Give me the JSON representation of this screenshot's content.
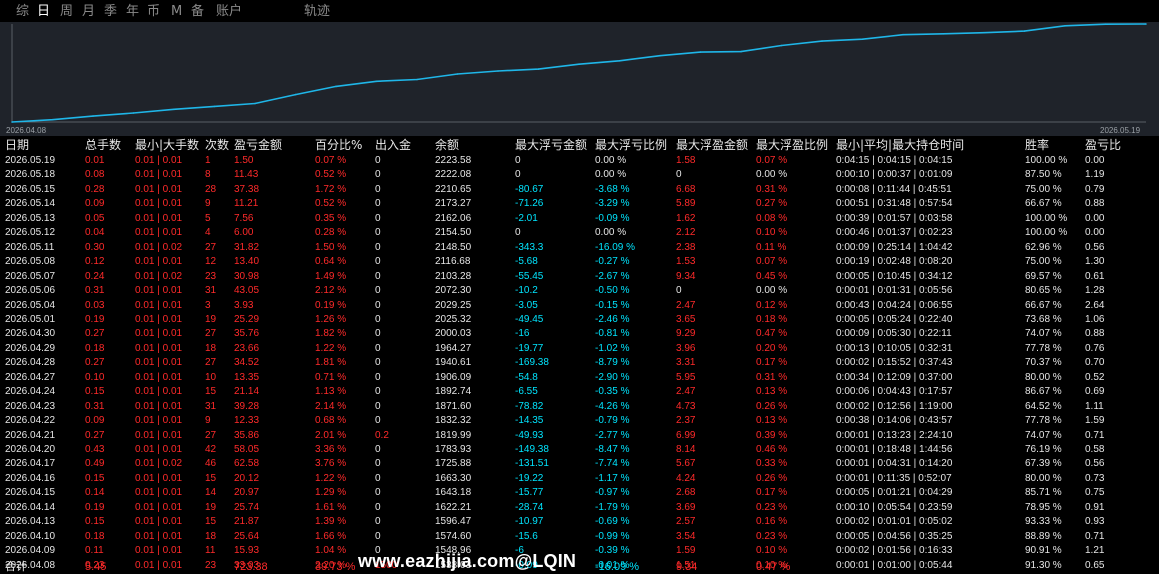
{
  "tabs": [
    {
      "label": "综",
      "active": false
    },
    {
      "label": "日",
      "active": true
    },
    {
      "label": "周",
      "active": false
    },
    {
      "label": "月",
      "active": false
    },
    {
      "label": "季",
      "active": false
    },
    {
      "label": "年",
      "active": false
    },
    {
      "label": "币",
      "active": false
    },
    {
      "label": "M",
      "active": false
    },
    {
      "label": "备",
      "active": false
    },
    {
      "label": "账户",
      "active": false
    },
    {
      "label": "轨迹",
      "active": false
    }
  ],
  "colors": {
    "line": "#1fb6e8",
    "panel": "#1f232a",
    "red": "#ff2a2a",
    "cyan": "#00e5ff"
  },
  "chart_data": {
    "type": "line",
    "x_start_label": "2026.04.08",
    "x_end_label": "2026.05.19",
    "x": [
      "2026.04.08",
      "2026.04.09",
      "2026.04.10",
      "2026.04.13",
      "2026.04.14",
      "2026.04.15",
      "2026.04.16",
      "2026.04.17",
      "2026.04.20",
      "2026.04.21",
      "2026.04.22",
      "2026.04.23",
      "2026.04.24",
      "2026.04.27",
      "2026.04.28",
      "2026.04.29",
      "2026.04.30",
      "2026.05.01",
      "2026.05.04",
      "2026.05.06",
      "2026.05.07",
      "2026.05.08",
      "2026.05.11",
      "2026.05.12",
      "2026.05.13",
      "2026.05.14",
      "2026.05.15",
      "2026.05.18",
      "2026.05.19"
    ],
    "values": [
      1533.03,
      1548.96,
      1574.6,
      1596.47,
      1622.21,
      1643.18,
      1663.3,
      1725.88,
      1783.93,
      1819.99,
      1832.32,
      1871.6,
      1892.74,
      1906.09,
      1940.61,
      1964.27,
      2000.03,
      2025.32,
      2029.25,
      2072.3,
      2103.28,
      2116.68,
      2148.5,
      2154.5,
      2162.06,
      2173.27,
      2210.65,
      2222.08,
      2223.58
    ],
    "grid": false,
    "legend": false
  },
  "headers": [
    "日期",
    "总手数",
    "最小|大手数",
    "次数",
    "盈亏金额",
    "百分比%",
    "出入金",
    "余额",
    "最大浮亏金额",
    "最大浮亏比例",
    "最大浮盈金额",
    "最大浮盈比例",
    "最小|平均|最大持仓时间",
    "胜率",
    "盈亏比"
  ],
  "rows": [
    [
      "2026.05.19",
      "0.01",
      "0.01 | 0.01",
      "1",
      "1.50",
      "0.07 %",
      "0",
      "2223.58",
      "0",
      "0.00 %",
      "1.58",
      "0.07 %",
      "0:04:15 | 0:04:15 | 0:04:15",
      "100.00 %",
      "0.00"
    ],
    [
      "2026.05.18",
      "0.08",
      "0.01 | 0.01",
      "8",
      "11.43",
      "0.52 %",
      "0",
      "2222.08",
      "0",
      "0.00 %",
      "0",
      "0.00 %",
      "0:00:10 | 0:00:37 | 0:01:09",
      "87.50 %",
      "1.19"
    ],
    [
      "2026.05.15",
      "0.28",
      "0.01 | 0.01",
      "28",
      "37.38",
      "1.72 %",
      "0",
      "2210.65",
      "-80.67",
      "-3.68 %",
      "6.68",
      "0.31 %",
      "0:00:08 | 0:11:44 | 0:45:51",
      "75.00 %",
      "0.79"
    ],
    [
      "2026.05.14",
      "0.09",
      "0.01 | 0.01",
      "9",
      "11.21",
      "0.52 %",
      "0",
      "2173.27",
      "-71.26",
      "-3.29 %",
      "5.89",
      "0.27 %",
      "0:00:51 | 0:31:48 | 0:57:54",
      "66.67 %",
      "0.88"
    ],
    [
      "2026.05.13",
      "0.05",
      "0.01 | 0.01",
      "5",
      "7.56",
      "0.35 %",
      "0",
      "2162.06",
      "-2.01",
      "-0.09 %",
      "1.62",
      "0.08 %",
      "0:00:39 | 0:01:57 | 0:03:58",
      "100.00 %",
      "0.00"
    ],
    [
      "2026.05.12",
      "0.04",
      "0.01 | 0.01",
      "4",
      "6.00",
      "0.28 %",
      "0",
      "2154.50",
      "0",
      "0.00 %",
      "2.12",
      "0.10 %",
      "0:00:46 | 0:01:37 | 0:02:23",
      "100.00 %",
      "0.00"
    ],
    [
      "2026.05.11",
      "0.30",
      "0.01 | 0.02",
      "27",
      "31.82",
      "1.50 %",
      "0",
      "2148.50",
      "-343.3",
      "-16.09 %",
      "2.38",
      "0.11 %",
      "0:00:09 | 0:25:14 | 1:04:42",
      "62.96 %",
      "0.56"
    ],
    [
      "2026.05.08",
      "0.12",
      "0.01 | 0.01",
      "12",
      "13.40",
      "0.64 %",
      "0",
      "2116.68",
      "-5.68",
      "-0.27 %",
      "1.53",
      "0.07 %",
      "0:00:19 | 0:02:48 | 0:08:20",
      "75.00 %",
      "1.30"
    ],
    [
      "2026.05.07",
      "0.24",
      "0.01 | 0.02",
      "23",
      "30.98",
      "1.49 %",
      "0",
      "2103.28",
      "-55.45",
      "-2.67 %",
      "9.34",
      "0.45 %",
      "0:00:05 | 0:10:45 | 0:34:12",
      "69.57 %",
      "0.61"
    ],
    [
      "2026.05.06",
      "0.31",
      "0.01 | 0.01",
      "31",
      "43.05",
      "2.12 %",
      "0",
      "2072.30",
      "-10.2",
      "-0.50 %",
      "0",
      "0.00 %",
      "0:00:01 | 0:01:31 | 0:05:56",
      "80.65 %",
      "1.28"
    ],
    [
      "2026.05.04",
      "0.03",
      "0.01 | 0.01",
      "3",
      "3.93",
      "0.19 %",
      "0",
      "2029.25",
      "-3.05",
      "-0.15 %",
      "2.47",
      "0.12 %",
      "0:00:43 | 0:04:24 | 0:06:55",
      "66.67 %",
      "2.64"
    ],
    [
      "2026.05.01",
      "0.19",
      "0.01 | 0.01",
      "19",
      "25.29",
      "1.26 %",
      "0",
      "2025.32",
      "-49.45",
      "-2.46 %",
      "3.65",
      "0.18 %",
      "0:00:05 | 0:05:24 | 0:22:40",
      "73.68 %",
      "1.06"
    ],
    [
      "2026.04.30",
      "0.27",
      "0.01 | 0.01",
      "27",
      "35.76",
      "1.82 %",
      "0",
      "2000.03",
      "-16",
      "-0.81 %",
      "9.29",
      "0.47 %",
      "0:00:09 | 0:05:30 | 0:22:11",
      "74.07 %",
      "0.88"
    ],
    [
      "2026.04.29",
      "0.18",
      "0.01 | 0.01",
      "18",
      "23.66",
      "1.22 %",
      "0",
      "1964.27",
      "-19.77",
      "-1.02 %",
      "3.96",
      "0.20 %",
      "0:00:13 | 0:10:05 | 0:32:31",
      "77.78 %",
      "0.76"
    ],
    [
      "2026.04.28",
      "0.27",
      "0.01 | 0.01",
      "27",
      "34.52",
      "1.81 %",
      "0",
      "1940.61",
      "-169.38",
      "-8.79 %",
      "3.31",
      "0.17 %",
      "0:00:02 | 0:15:52 | 0:37:43",
      "70.37 %",
      "0.70"
    ],
    [
      "2026.04.27",
      "0.10",
      "0.01 | 0.01",
      "10",
      "13.35",
      "0.71 %",
      "0",
      "1906.09",
      "-54.8",
      "-2.90 %",
      "5.95",
      "0.31 %",
      "0:00:34 | 0:12:09 | 0:37:00",
      "80.00 %",
      "0.52"
    ],
    [
      "2026.04.24",
      "0.15",
      "0.01 | 0.01",
      "15",
      "21.14",
      "1.13 %",
      "0",
      "1892.74",
      "-6.55",
      "-0.35 %",
      "2.47",
      "0.13 %",
      "0:00:06 | 0:04:43 | 0:17:57",
      "86.67 %",
      "0.69"
    ],
    [
      "2026.04.23",
      "0.31",
      "0.01 | 0.01",
      "31",
      "39.28",
      "2.14 %",
      "0",
      "1871.60",
      "-78.82",
      "-4.26 %",
      "4.73",
      "0.26 %",
      "0:00:02 | 0:12:56 | 1:19:00",
      "64.52 %",
      "1.11"
    ],
    [
      "2026.04.22",
      "0.09",
      "0.01 | 0.01",
      "9",
      "12.33",
      "0.68 %",
      "0",
      "1832.32",
      "-14.35",
      "-0.79 %",
      "2.37",
      "0.13 %",
      "0:00:38 | 0:14:06 | 0:43:57",
      "77.78 %",
      "1.59"
    ],
    [
      "2026.04.21",
      "0.27",
      "0.01 | 0.01",
      "27",
      "35.86",
      "2.01 %",
      "0.2",
      "1819.99",
      "-49.93",
      "-2.77 %",
      "6.99",
      "0.39 %",
      "0:00:01 | 0:13:23 | 2:24:10",
      "74.07 %",
      "0.71"
    ],
    [
      "2026.04.20",
      "0.43",
      "0.01 | 0.01",
      "42",
      "58.05",
      "3.36 %",
      "0",
      "1783.93",
      "-149.38",
      "-8.47 %",
      "8.14",
      "0.46 %",
      "0:00:01 | 0:18:48 | 1:44:56",
      "76.19 %",
      "0.58"
    ],
    [
      "2026.04.17",
      "0.49",
      "0.01 | 0.02",
      "46",
      "62.58",
      "3.76 %",
      "0",
      "1725.88",
      "-131.51",
      "-7.74 %",
      "5.67",
      "0.33 %",
      "0:00:01 | 0:04:31 | 0:14:20",
      "67.39 %",
      "0.56"
    ],
    [
      "2026.04.16",
      "0.15",
      "0.01 | 0.01",
      "15",
      "20.12",
      "1.22 %",
      "0",
      "1663.30",
      "-19.22",
      "-1.17 %",
      "4.24",
      "0.26 %",
      "0:00:01 | 0:11:35 | 0:52:07",
      "80.00 %",
      "0.73"
    ],
    [
      "2026.04.15",
      "0.14",
      "0.01 | 0.01",
      "14",
      "20.97",
      "1.29 %",
      "0",
      "1643.18",
      "-15.77",
      "-0.97 %",
      "2.68",
      "0.17 %",
      "0:00:05 | 0:01:21 | 0:04:29",
      "85.71 %",
      "0.75"
    ],
    [
      "2026.04.14",
      "0.19",
      "0.01 | 0.01",
      "19",
      "25.74",
      "1.61 %",
      "0",
      "1622.21",
      "-28.74",
      "-1.79 %",
      "3.69",
      "0.23 %",
      "0:00:10 | 0:05:54 | 0:23:59",
      "78.95 %",
      "0.91"
    ],
    [
      "2026.04.13",
      "0.15",
      "0.01 | 0.01",
      "15",
      "21.87",
      "1.39 %",
      "0",
      "1596.47",
      "-10.97",
      "-0.69 %",
      "2.57",
      "0.16 %",
      "0:00:02 | 0:01:01 | 0:05:02",
      "93.33 %",
      "0.93"
    ],
    [
      "2026.04.10",
      "0.18",
      "0.01 | 0.01",
      "18",
      "25.64",
      "1.66 %",
      "0",
      "1574.60",
      "-15.6",
      "-0.99 %",
      "3.54",
      "0.23 %",
      "0:00:05 | 0:04:56 | 0:35:25",
      "88.89 %",
      "0.71"
    ],
    [
      "2026.04.09",
      "0.11",
      "0.01 | 0.01",
      "11",
      "15.93",
      "1.04 %",
      "0",
      "1548.96",
      "-6",
      "-0.39 %",
      "1.59",
      "0.10 %",
      "0:00:02 | 0:01:56 | 0:16:33",
      "90.91 %",
      "1.21"
    ],
    [
      "2026.04.08",
      "0.23",
      "0.01 | 0.01",
      "23",
      "33.03",
      "2.20 %",
      "1500",
      "1533.03",
      "-0.09",
      "-0.01 %",
      "1.51",
      "0.10 %",
      "0:00:01 | 0:01:00 | 0:05:44",
      "91.30 %",
      "0.65"
    ]
  ],
  "total": {
    "label": "合计",
    "lots": "5.45",
    "profit": "723.38",
    "percent": "39.73 %",
    "float_loss_pct": "-16.09 %",
    "float_profit": "9.34",
    "float_profit_pct": "0.47 %"
  },
  "watermark": "www.eazhijia.com@LQIN"
}
